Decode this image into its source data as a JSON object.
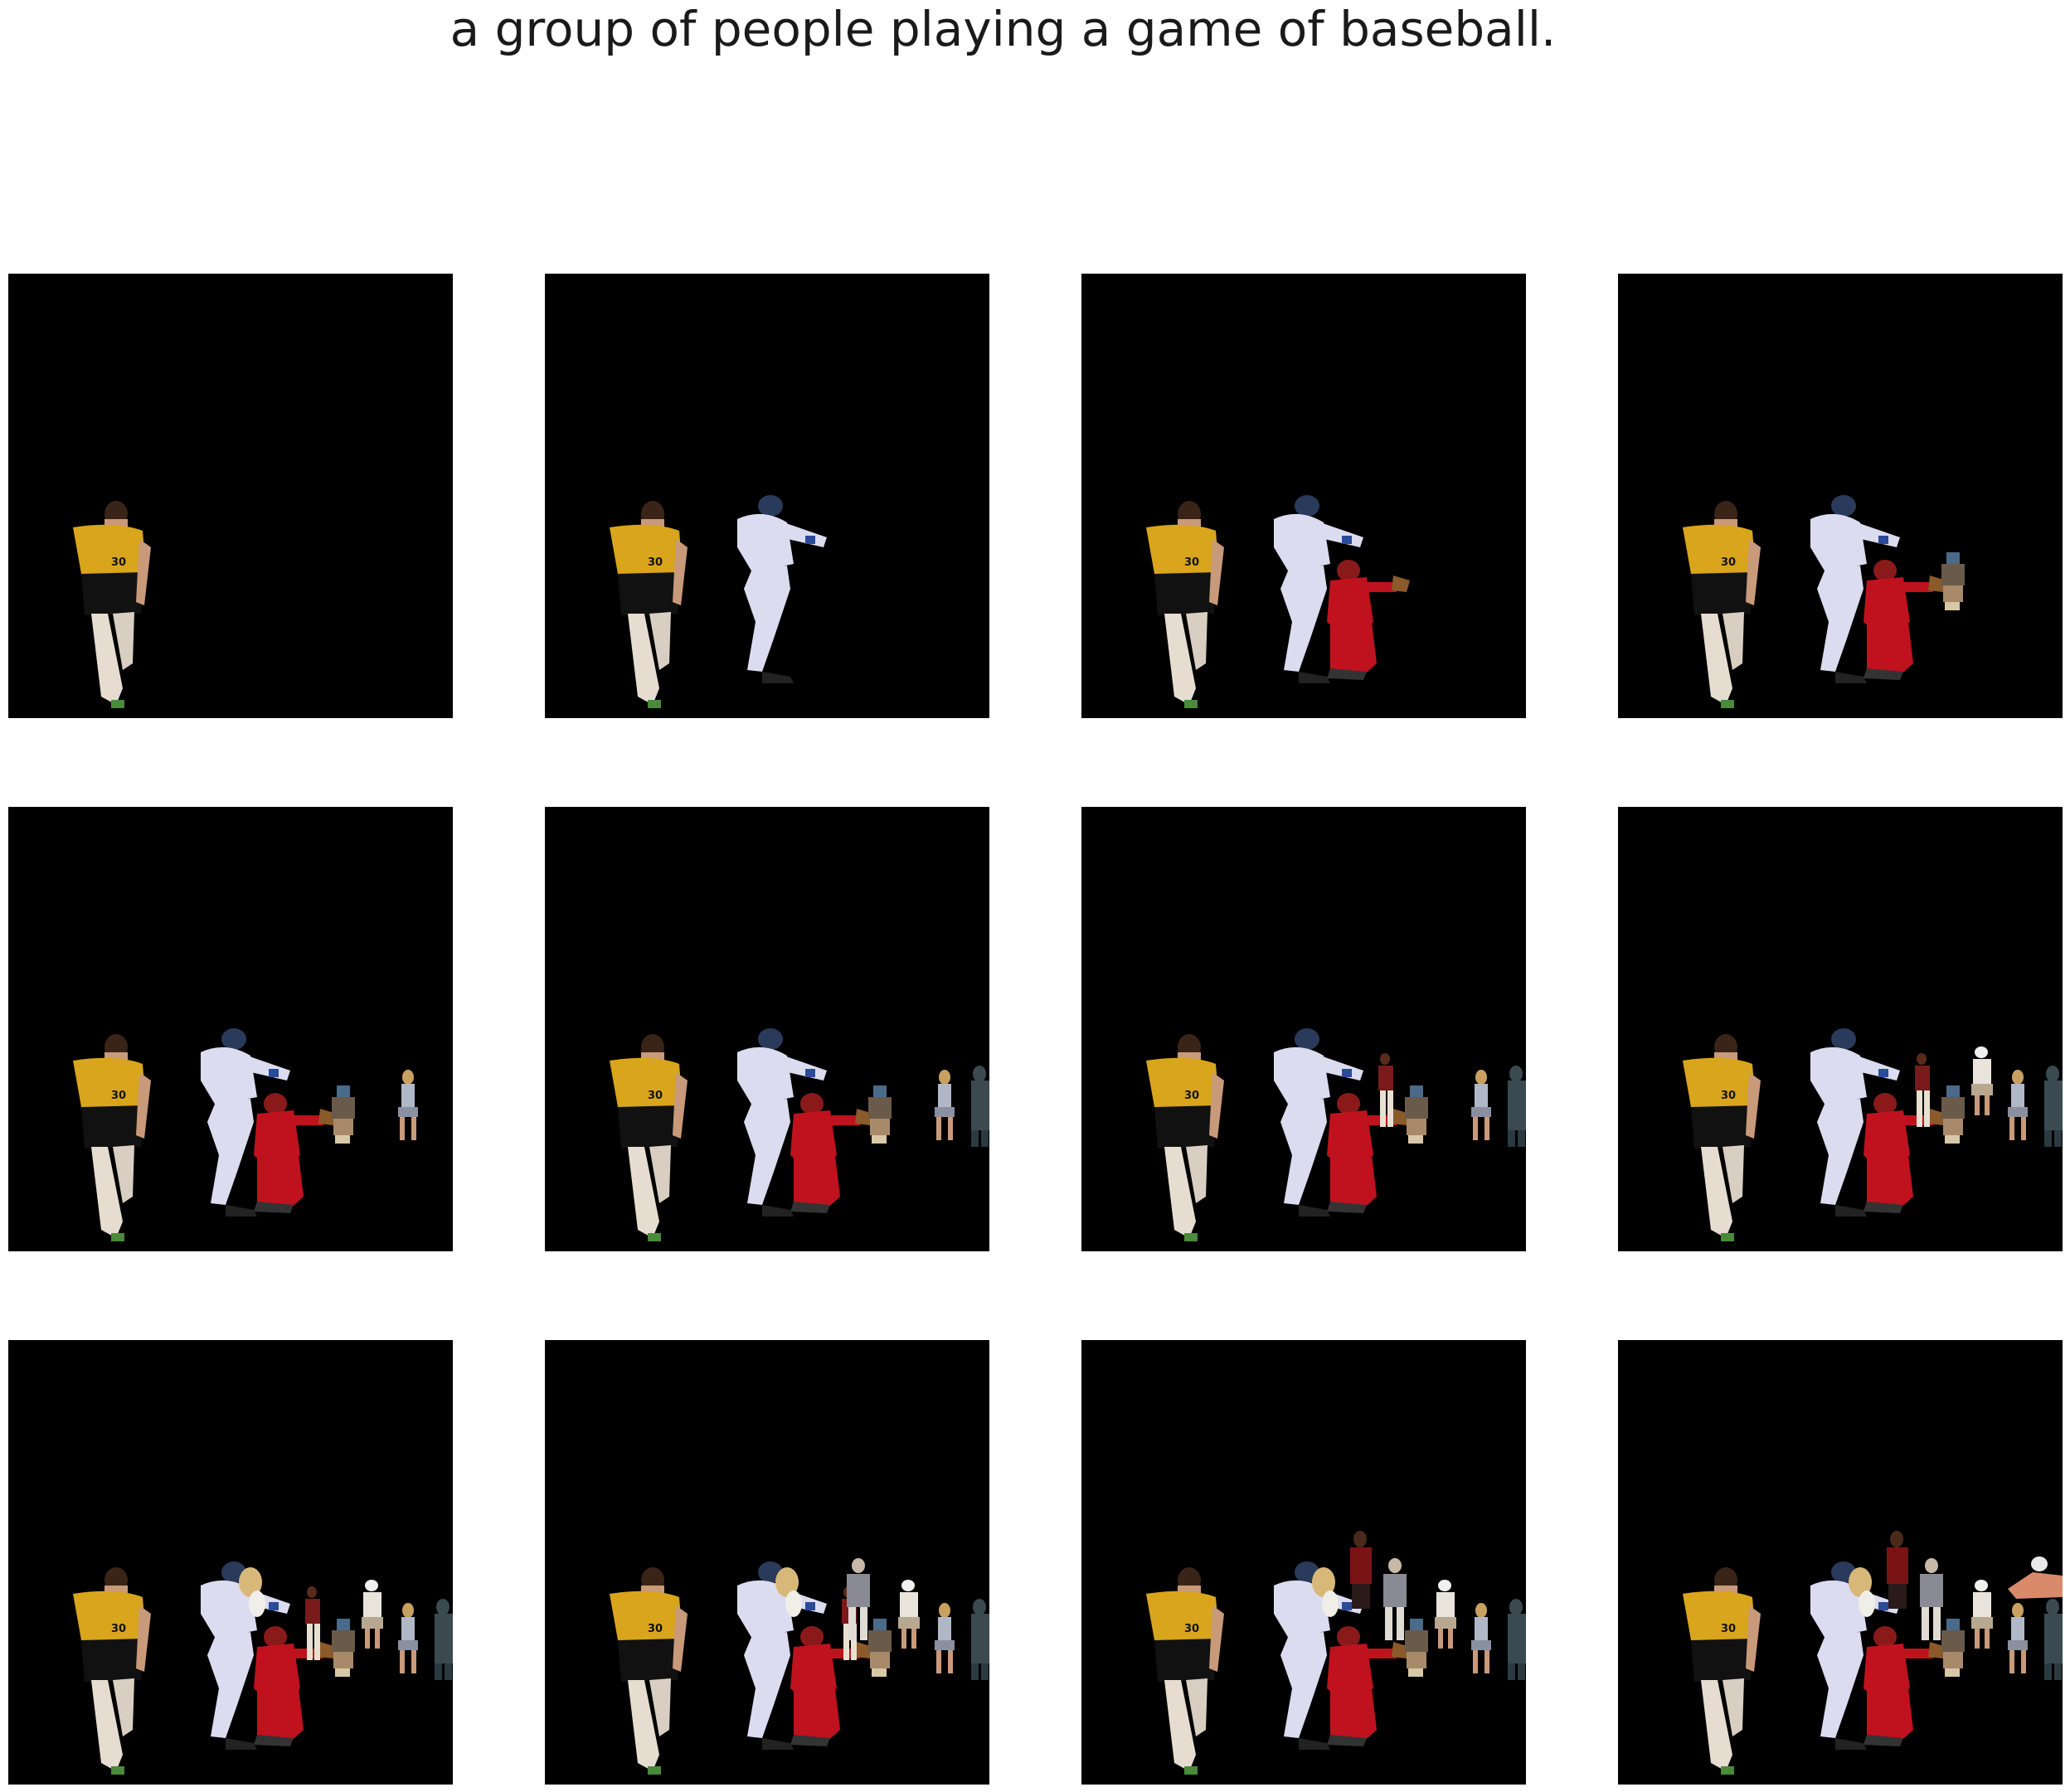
{
  "caption": "a group of people playing a game of baseball.",
  "colors": {
    "background": "#ffffff",
    "panel": "#000000",
    "jersey_yellow": "#d9a51c",
    "uniform_white": "#dcdcf0",
    "catcher_red": "#c0121e",
    "umpire_maroon": "#7a1a1a",
    "checker_gray": "#3a4a50"
  },
  "frames": [
    {
      "figures": [
        "woman-yellow-jersey"
      ]
    },
    {
      "figures": [
        "woman-yellow-jersey",
        "batter"
      ]
    },
    {
      "figures": [
        "woman-yellow-jersey",
        "batter",
        "catcher"
      ]
    },
    {
      "figures": [
        "woman-yellow-jersey",
        "batter",
        "catcher",
        "small-kneeling"
      ]
    },
    {
      "figures": [
        "woman-yellow-jersey",
        "batter",
        "catcher",
        "small-kneeling",
        "seated-woman"
      ]
    },
    {
      "figures": [
        "woman-yellow-jersey",
        "batter",
        "catcher",
        "small-kneeling",
        "seated-woman",
        "checkered-figure"
      ]
    },
    {
      "figures": [
        "woman-yellow-jersey",
        "batter",
        "catcher",
        "small-kneeling",
        "seated-woman",
        "checkered-figure",
        "maroon-standing"
      ]
    },
    {
      "figures": [
        "woman-yellow-jersey",
        "batter",
        "catcher",
        "small-kneeling",
        "seated-woman",
        "checkered-figure",
        "maroon-standing",
        "white-shirt-seated"
      ]
    },
    {
      "figures": [
        "woman-yellow-jersey",
        "batter",
        "catcher",
        "small-kneeling",
        "seated-woman",
        "checkered-figure",
        "maroon-standing",
        "white-shirt-seated",
        "blurred-head"
      ]
    },
    {
      "figures": [
        "woman-yellow-jersey",
        "batter",
        "catcher",
        "small-kneeling",
        "seated-woman",
        "checkered-figure",
        "maroon-standing",
        "white-shirt-seated",
        "blurred-head",
        "plaid-standing"
      ]
    },
    {
      "figures": [
        "woman-yellow-jersey",
        "batter",
        "catcher",
        "small-kneeling",
        "seated-woman",
        "checkered-figure",
        "white-shirt-seated",
        "blurred-head",
        "plaid-standing",
        "red-tall"
      ]
    },
    {
      "figures": [
        "woman-yellow-jersey",
        "batter",
        "catcher",
        "small-kneeling",
        "seated-woman",
        "checkered-figure",
        "white-shirt-seated",
        "blurred-head",
        "plaid-standing",
        "red-tall",
        "bare-arm-right"
      ]
    }
  ]
}
